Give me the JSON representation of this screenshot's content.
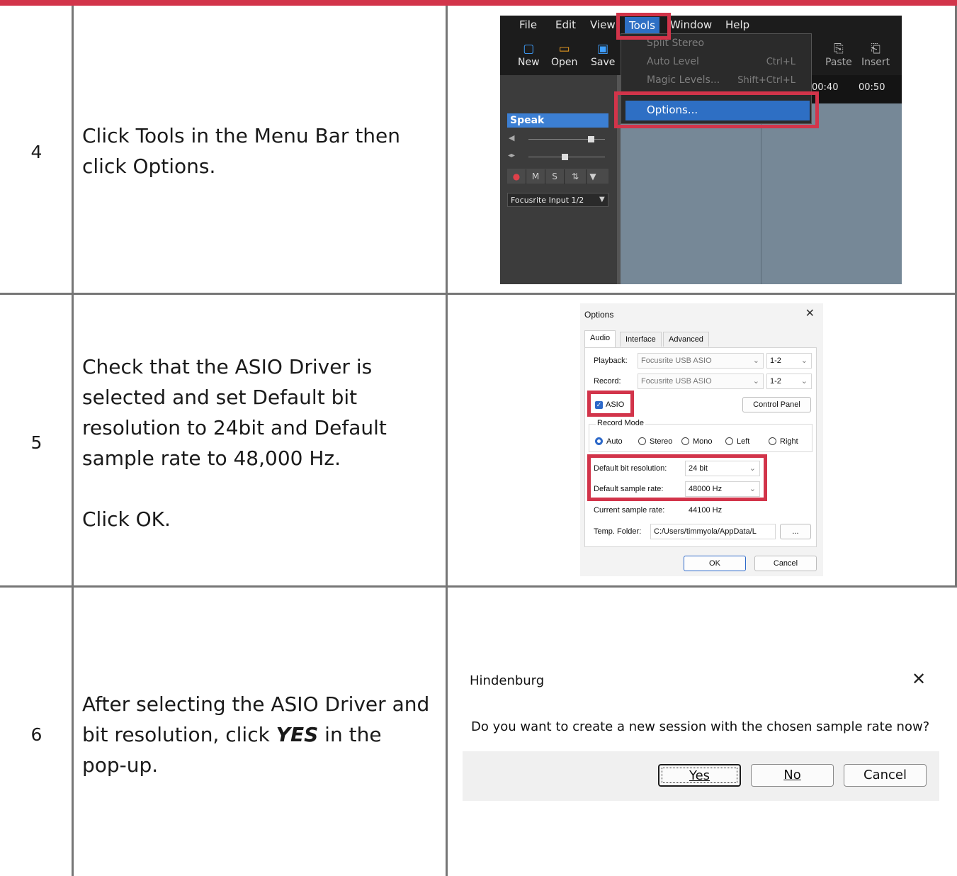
{
  "rows": [
    {
      "number": "4",
      "lines": [
        "Click Tools in the Menu Bar then",
        "click Options."
      ]
    },
    {
      "number": "5",
      "lines": [
        "Check that the ASIO Driver is",
        "selected and set Default bit",
        "resolution to 24bit and Default",
        "sample rate to 48,000 Hz."
      ],
      "extra": "Click OK."
    },
    {
      "number": "6",
      "lines": [
        "After selecting the ASIO Driver and",
        "pop-up."
      ],
      "line2_pre": "bit resolution, click ",
      "line2_bold": "YES",
      "line2_post": " in the"
    }
  ],
  "daw": {
    "menu": [
      "File",
      "Edit",
      "View",
      "Tools",
      "Window",
      "Help"
    ],
    "toolbar": [
      {
        "label": "New",
        "icon": "new-file-icon"
      },
      {
        "label": "Open",
        "icon": "open-folder-icon"
      },
      {
        "label": "Save",
        "icon": "save-icon"
      },
      {
        "label": "Paste",
        "icon": "paste-icon"
      },
      {
        "label": "Insert",
        "icon": "insert-icon"
      }
    ],
    "dropdown": [
      {
        "label": "Split Stereo",
        "shortcut": ""
      },
      {
        "label": "Auto Level",
        "shortcut": "Ctrl+L"
      },
      {
        "label": "Magic Levels...",
        "shortcut": "Shift+Ctrl+L"
      }
    ],
    "selected_item": "Options...",
    "timeline": [
      "00:40",
      "00:50"
    ],
    "track_name": "Speak",
    "track_buttons": [
      "●",
      "M",
      "S",
      "⇅",
      "▼"
    ],
    "input": "Focusrite Input 1/2"
  },
  "options": {
    "title": "Options",
    "tabs": [
      "Audio",
      "Interface",
      "Advanced"
    ],
    "playback_label": "Playback:",
    "playback_device": "Focusrite USB ASIO",
    "playback_channels": "1-2",
    "record_label": "Record:",
    "record_device": "Focusrite USB ASIO",
    "record_channels": "1-2",
    "asio_label": "ASIO",
    "control_panel": "Control Panel",
    "record_mode_label": "Record Mode",
    "record_modes": [
      "Auto",
      "Stereo",
      "Mono",
      "Left",
      "Right"
    ],
    "bit_res_label": "Default bit resolution:",
    "bit_res_value": "24 bit",
    "sample_rate_label": "Default sample rate:",
    "sample_rate_value": "48000 Hz",
    "current_rate_label": "Current sample rate:",
    "current_rate_value": "44100 Hz",
    "temp_label": "Temp. Folder:",
    "temp_value": "C:/Users/timmyola/AppData/L",
    "browse": "...",
    "ok": "OK",
    "cancel": "Cancel"
  },
  "popup": {
    "title": "Hindenburg",
    "message": "Do you want to create a new session with the chosen sample rate now?",
    "yes": "Yes",
    "no": "No",
    "cancel": "Cancel"
  },
  "colors": {
    "highlight": "#d2344a",
    "accent": "#2e6fc4"
  }
}
